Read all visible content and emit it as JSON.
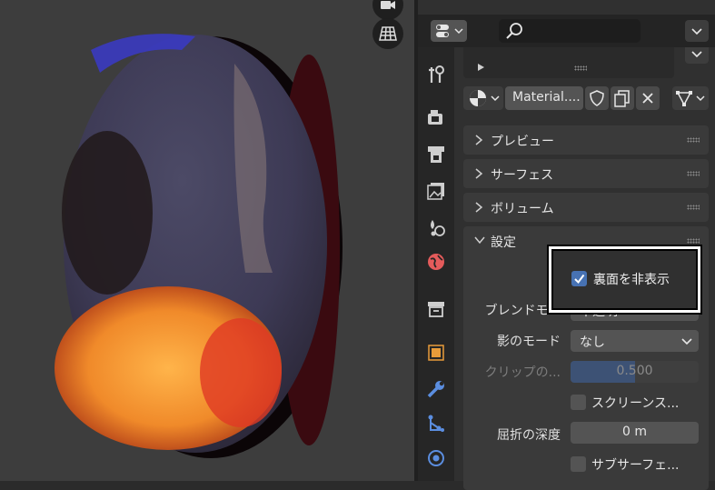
{
  "properties": {
    "material_slot_name": "Material....",
    "sections": {
      "preview": "プレビュー",
      "surface": "サーフェス",
      "volume": "ボリューム",
      "settings": "設定"
    },
    "settings": {
      "backface_culling_label": "裏面を非表示",
      "backface_culling_checked": true,
      "blend_mode_label": "ブレンドモ...",
      "blend_mode_value": "不透明",
      "shadow_mode_label": "影のモード",
      "shadow_mode_value": "なし",
      "clip_label": "クリップの...",
      "clip_value": "0.500",
      "screen_space_label": "スクリーンス...",
      "refraction_depth_label": "屈折の深度",
      "refraction_depth_value": "0 m",
      "subsurface_label": "サブサーフェ..."
    }
  },
  "colors": {
    "accent": "#4772b3",
    "highlight_border": "#ffffff",
    "material_tab_icon": "#e45b5b"
  }
}
